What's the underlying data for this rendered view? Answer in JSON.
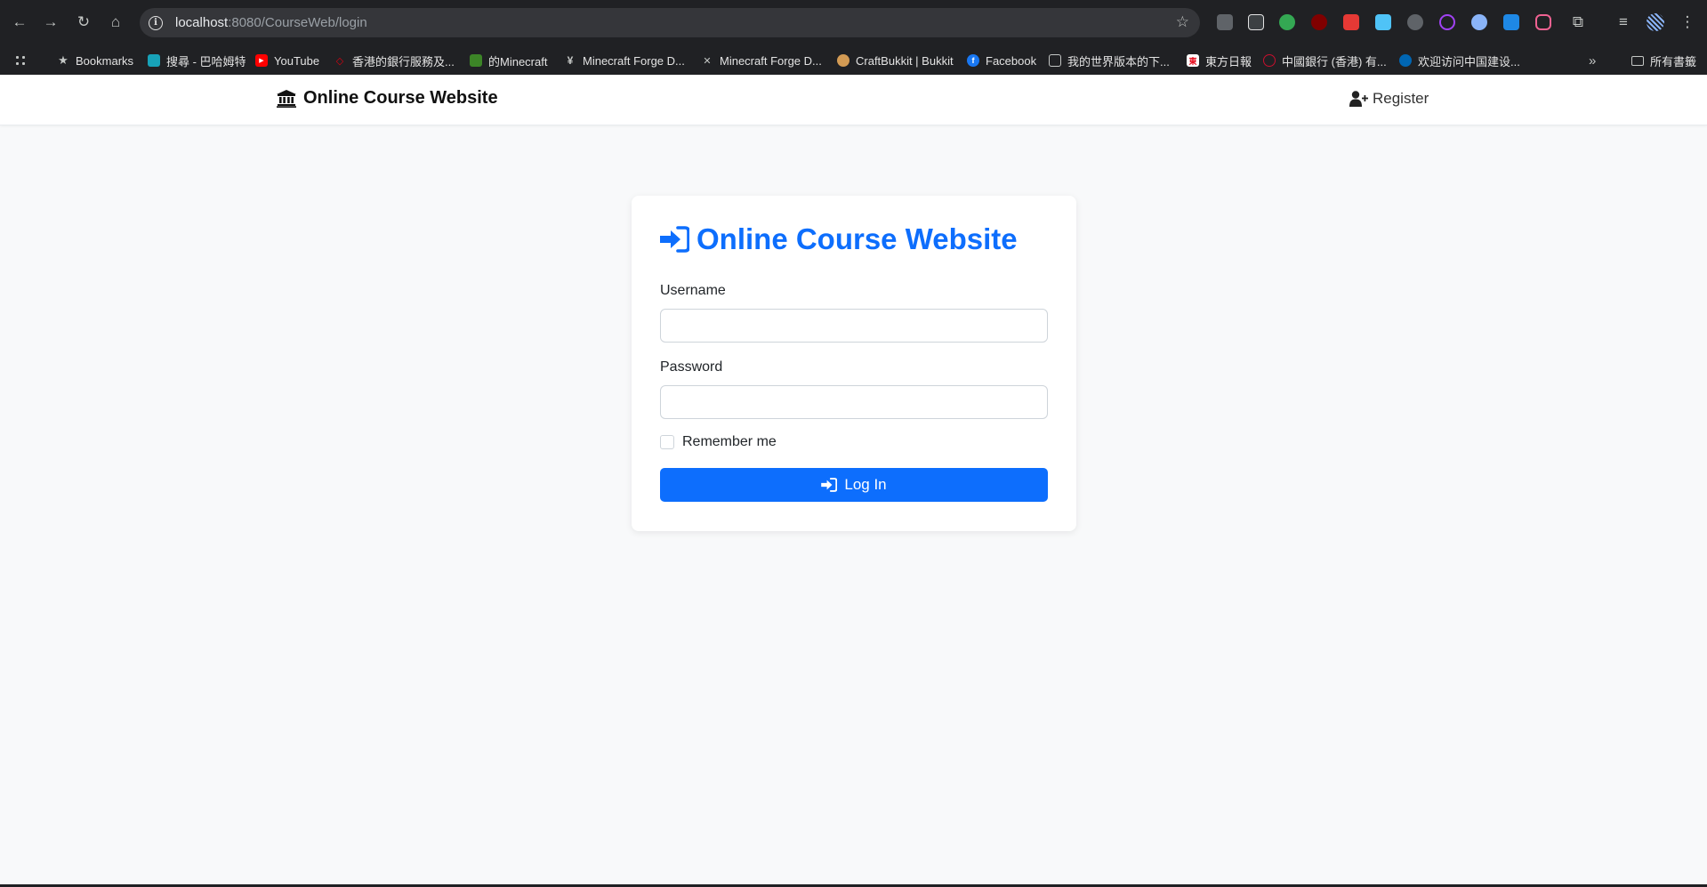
{
  "browser": {
    "url_host": "localhost",
    "url_path": ":8080/CourseWeb/login",
    "bookmarks": [
      {
        "label": "Bookmarks",
        "color": "#c4c7c5"
      },
      {
        "label": "搜尋 - 巴哈姆特",
        "color": "#17a2b8"
      },
      {
        "label": "YouTube",
        "color": "#ff0000"
      },
      {
        "label": "香港的銀行服務及...",
        "color": "#db0011"
      },
      {
        "label": "的Minecraft",
        "color": "#3c8527"
      },
      {
        "label": "Minecraft Forge D...",
        "color": "#c4c7c5"
      },
      {
        "label": "Minecraft Forge D...",
        "color": "#c4c7c5"
      },
      {
        "label": "CraftBukkit | Bukkit",
        "color": "#d39b54"
      },
      {
        "label": "Facebook",
        "color": "#1877f2"
      },
      {
        "label": "我的世界版本的下...",
        "color": "#c4c7c5"
      },
      {
        "label": "東方日報",
        "color": "#e60012"
      },
      {
        "label": "中國銀行 (香港) 有...",
        "color": "#c8102e"
      },
      {
        "label": "欢迎访问中国建设...",
        "color": "#0066b3"
      }
    ],
    "all_bookmarks": "所有書籤"
  },
  "navbar": {
    "brand": "Online Course Website",
    "register": "Register"
  },
  "login": {
    "title": "Online Course Website",
    "username_label": "Username",
    "password_label": "Password",
    "remember_label": "Remember me",
    "submit_label": "Log In",
    "accent": "#0d6efd"
  }
}
